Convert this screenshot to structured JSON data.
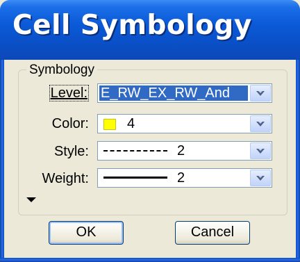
{
  "window": {
    "title": "Cell Symbology"
  },
  "group": {
    "label": "Symbology"
  },
  "fields": {
    "level": {
      "label": "Level:",
      "value": "E_RW_EX_RW_And"
    },
    "color": {
      "label": "Color:",
      "value": "4",
      "swatch_color": "#ffff00"
    },
    "style": {
      "label": "Style:",
      "value": "2"
    },
    "weight": {
      "label": "Weight:",
      "value": "2"
    }
  },
  "buttons": {
    "ok": "OK",
    "cancel": "Cancel"
  },
  "icons": {
    "dropdown": "chevron-down-icon",
    "expand": "triangle-down-icon"
  }
}
